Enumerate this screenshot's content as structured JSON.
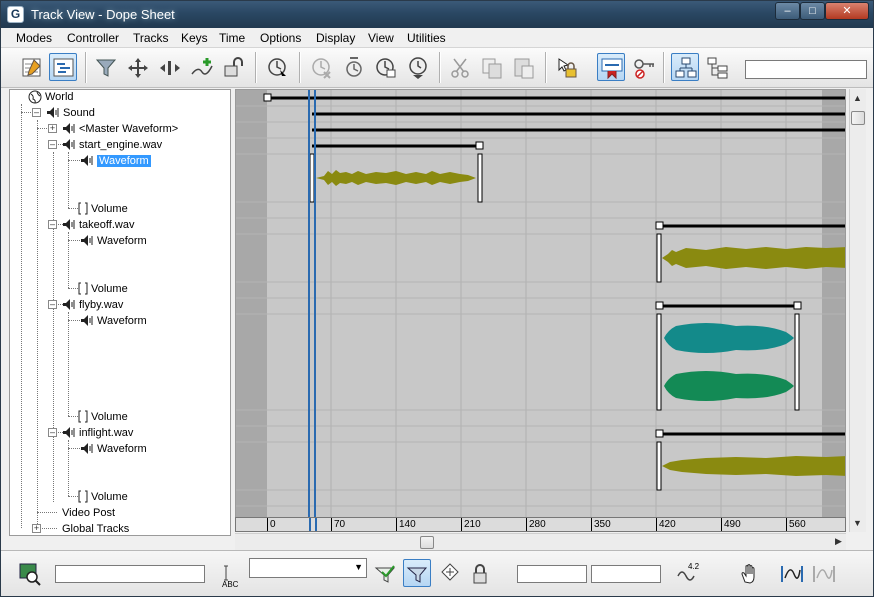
{
  "window": {
    "title": "Track View - Dope Sheet",
    "app_icon": "G",
    "minimize_glyph": "–",
    "maximize_glyph": "□",
    "close_glyph": "✕"
  },
  "menu": [
    "Modes",
    "Controller",
    "Tracks",
    "Keys",
    "Time",
    "Options",
    "Display",
    "View",
    "Utilities"
  ],
  "toolbar": {
    "icons": [
      "edit-keys-icon",
      "edit-ranges-icon",
      "filter-icon",
      "move-keys-icon",
      "slide-keys-icon",
      "add-keys-icon",
      "snap-frames-icon",
      "select-time-icon",
      "delete-time-icon",
      "scale-time-icon",
      "insert-time-icon",
      "reduce-keys-icon",
      "cut-icon",
      "copy-icon",
      "paste-icon",
      "lock-selection-icon",
      "show-selected-keys-icon",
      "key-lock-icon",
      "hierarchy-view-icon",
      "tree-view-icon"
    ],
    "name_field": ""
  },
  "tree": {
    "items": [
      {
        "label": "World",
        "icon": "globe-icon"
      },
      {
        "label": "Sound",
        "icon": "speaker-icon"
      },
      {
        "label": "<Master Waveform>",
        "icon": "speaker-icon"
      },
      {
        "label": "start_engine.wav",
        "icon": "speaker-icon"
      },
      {
        "label": "Waveform",
        "icon": "speaker-icon",
        "selected": true
      },
      {
        "label": "Volume",
        "icon": "bracket-icon"
      },
      {
        "label": "takeoff.wav",
        "icon": "speaker-icon"
      },
      {
        "label": "Waveform",
        "icon": "speaker-icon"
      },
      {
        "label": "Volume",
        "icon": "bracket-icon"
      },
      {
        "label": "flyby.wav",
        "icon": "speaker-icon"
      },
      {
        "label": "Waveform",
        "icon": "speaker-icon"
      },
      {
        "label": "Volume",
        "icon": "bracket-icon"
      },
      {
        "label": "inflight.wav",
        "icon": "speaker-icon"
      },
      {
        "label": "Waveform",
        "icon": "speaker-icon"
      },
      {
        "label": "Volume",
        "icon": "bracket-icon"
      },
      {
        "label": "Video Post",
        "icon": ""
      },
      {
        "label": "Global Tracks",
        "icon": ""
      }
    ]
  },
  "timeline": {
    "ruler_labels": [
      "0",
      "70",
      "140",
      "210",
      "280",
      "350",
      "420",
      "490",
      "560"
    ],
    "current_frame": 20,
    "waveform_colors": {
      "start_engine": "#8a8a10",
      "takeoff": "#8a8a10",
      "flyby_left": "#138a8a",
      "flyby_right": "#138a55",
      "inflight": "#8a8a10"
    },
    "range_bar_color": "#000000",
    "grid_color": "#b0b0b0",
    "active_area_color": "#c8c8c8",
    "inactive_area_color": "#a8a8a8"
  },
  "statusbar": {
    "zoom_field": "",
    "selection_combo": "",
    "abc_label": "ABC",
    "frame_field_1": "",
    "frame_field_2": "",
    "value_label": "4.2"
  }
}
